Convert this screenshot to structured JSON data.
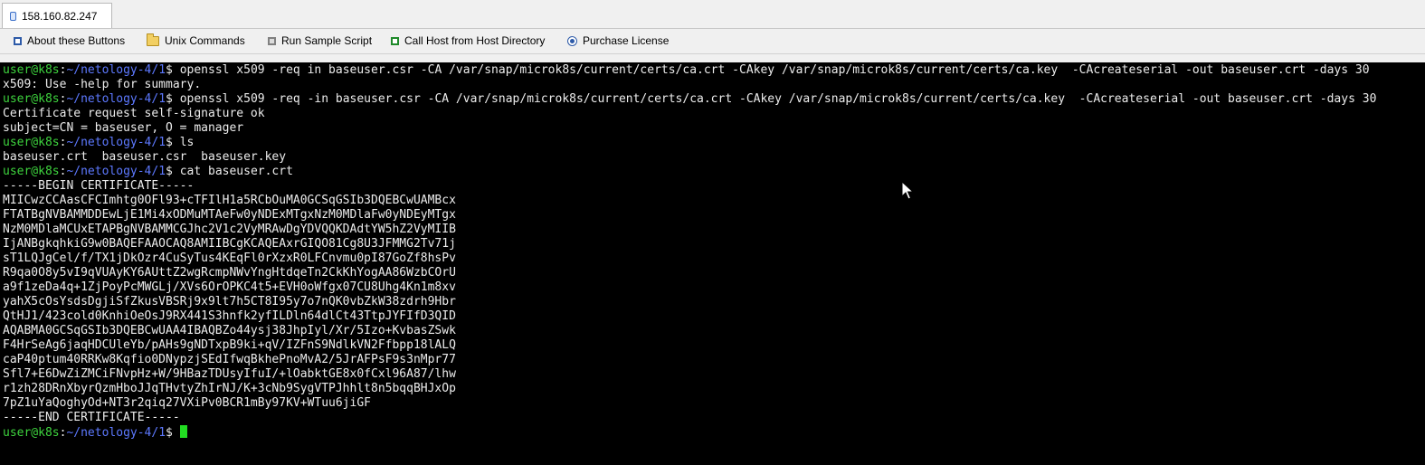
{
  "tab": {
    "title": "158.160.82.247"
  },
  "toolbar": {
    "items": [
      {
        "label": "About these Buttons",
        "icon": "square-blue-icon"
      },
      {
        "label": "Unix Commands",
        "icon": "folder-icon"
      },
      {
        "label": "Run Sample Script",
        "icon": "square-gray-icon"
      },
      {
        "label": "Call Host from Host Directory",
        "icon": "square-green-icon"
      },
      {
        "label": "Purchase License",
        "icon": "radio-icon"
      }
    ]
  },
  "terminal": {
    "prompt_user": "user@k8s",
    "prompt_sep": ":",
    "prompt_path": "~/netology-4/1",
    "prompt_end": "$ ",
    "lines": [
      {
        "prompt": true,
        "cmd": "openssl x509 -req in baseuser.csr -CA /var/snap/microk8s/current/certs/ca.crt -CAkey /var/snap/microk8s/current/certs/ca.key  -CAcreateserial -out baseuser.crt -days 30"
      },
      {
        "prompt": false,
        "text": "x509: Use -help for summary."
      },
      {
        "prompt": true,
        "cmd": "openssl x509 -req -in baseuser.csr -CA /var/snap/microk8s/current/certs/ca.crt -CAkey /var/snap/microk8s/current/certs/ca.key  -CAcreateserial -out baseuser.crt -days 30"
      },
      {
        "prompt": false,
        "text": "Certificate request self-signature ok"
      },
      {
        "prompt": false,
        "text": "subject=CN = baseuser, O = manager"
      },
      {
        "prompt": true,
        "cmd": "ls"
      },
      {
        "prompt": false,
        "text": "baseuser.crt  baseuser.csr  baseuser.key"
      },
      {
        "prompt": true,
        "cmd": "cat baseuser.crt"
      },
      {
        "prompt": false,
        "text": "-----BEGIN CERTIFICATE-----"
      },
      {
        "prompt": false,
        "text": "MIICwzCCAasCFCImhtg0OFl93+cTFIlH1a5RCbOuMA0GCSqGSIb3DQEBCwUAMBcx"
      },
      {
        "prompt": false,
        "text": "FTATBgNVBAMMDDEwLjE1Mi4xODMuMTAeFw0yNDExMTgxNzM0MDlaFw0yNDEyMTgx"
      },
      {
        "prompt": false,
        "text": "NzM0MDlaMCUxETAPBgNVBAMMCGJhc2V1c2VyMRAwDgYDVQQKDAdtYW5hZ2VyMIIB"
      },
      {
        "prompt": false,
        "text": "IjANBgkqhkiG9w0BAQEFAAOCAQ8AMIIBCgKCAQEAxrGIQO81Cg8U3JFMMG2Tv71j"
      },
      {
        "prompt": false,
        "text": "sT1LQJgCel/f/TX1jDkOzr4CuSyTus4KEqFl0rXzxR0LFCnvmu0pI87GoZf8hsPv"
      },
      {
        "prompt": false,
        "text": "R9qa0O8y5vI9qVUAyKY6AUttZ2wgRcmpNWvYngHtdqeTn2CkKhYogAA86WzbCOrU"
      },
      {
        "prompt": false,
        "text": "a9f1zeDa4q+1ZjPoyPcMWGLj/XVs6OrOPKC4t5+EVH0oWfgx07CU8Uhg4Kn1m8xv"
      },
      {
        "prompt": false,
        "text": "yahX5cOsYsdsDgjiSfZkusVBSRj9x9lt7h5CT8I95y7o7nQK0vbZkW38zdrh9Hbr"
      },
      {
        "prompt": false,
        "text": "QtHJ1/423cold0KnhiOeOsJ9RX441S3hnfk2yfILDln64dlCt43TtpJYFIfD3QID"
      },
      {
        "prompt": false,
        "text": "AQABMA0GCSqGSIb3DQEBCwUAA4IBAQBZo44ysj38JhpIyl/Xr/5Izo+KvbasZSwk"
      },
      {
        "prompt": false,
        "text": "F4HrSeAg6jaqHDCUleYb/pAHs9gNDTxpB9ki+qV/IZFnS9NdlkVN2Ffbpp18lALQ"
      },
      {
        "prompt": false,
        "text": "caP40ptum40RRKw8Kqfio0DNypzjSEdIfwqBkhePnoMvA2/5JrAFPsF9s3nMpr77"
      },
      {
        "prompt": false,
        "text": "Sfl7+E6DwZiZMCiFNvpHz+W/9HBazTDUsyIfuI/+lOabktGE8x0fCxl96A87/lhw"
      },
      {
        "prompt": false,
        "text": "r1zh28DRnXbyrQzmHboJJqTHvtyZhIrNJ/K+3cNb9SygVTPJhhlt8n5bqqBHJxOp"
      },
      {
        "prompt": false,
        "text": "7pZ1uYaQoghyOd+NT3r2qiq27VXiPv0BCR1mBy97KV+WTuu6jiGF"
      },
      {
        "prompt": false,
        "text": "-----END CERTIFICATE-----"
      },
      {
        "prompt": true,
        "cmd": "",
        "cursor": true
      }
    ]
  }
}
